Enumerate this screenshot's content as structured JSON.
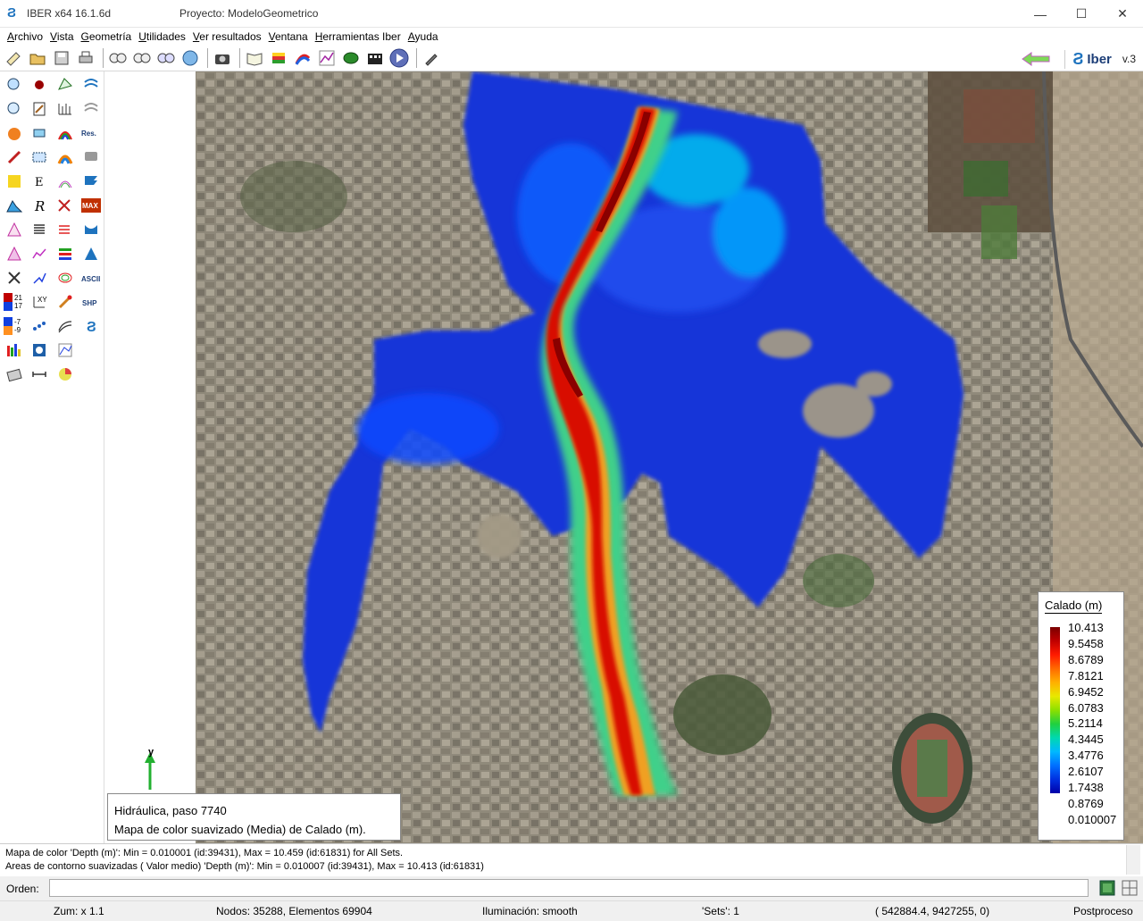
{
  "window": {
    "app_title": "IBER x64 16.1.6d",
    "project_title": "Proyecto: ModeloGeometrico",
    "minimize": "—",
    "maximize": "☐",
    "close": "✕"
  },
  "menu": [
    "Archivo",
    "Vista",
    "Geometría",
    "Utilidades",
    "Ver resultados",
    "Ventana",
    "Herramientas Iber",
    "Ayuda"
  ],
  "brand": {
    "logo_text": "Iber",
    "version": "v.3"
  },
  "legend": {
    "title": "Calado (m)",
    "values": [
      "10.413",
      "9.5458",
      "8.6789",
      "7.8121",
      "6.9452",
      "6.0783",
      "5.2114",
      "4.3445",
      "3.4776",
      "2.6107",
      "1.7438",
      "0.8769",
      "0.010007"
    ]
  },
  "left_panel_numbers": [
    "21",
    "17",
    "-7",
    "-9"
  ],
  "axis_label": "y",
  "info": {
    "line1": "Hidráulica, paso 7740",
    "line2": "Mapa de color suavizado (Media) de Calado (m)."
  },
  "messages": [
    "Mapa de color 'Depth (m)': Min = 0.010001 (id:39431), Max = 10.459 (id:61831) for All Sets.",
    "Areas de contorno suavizadas ( Valor medio) 'Depth (m)': Min = 0.010007 (id:39431), Max = 10.413 (id:61831)"
  ],
  "command": {
    "label": "Orden:",
    "value": ""
  },
  "status": {
    "zoom": "Zum: x 1.1",
    "nodes": "Nodos: 35288, Elementos 69904",
    "lighting": "Iluminación: smooth",
    "sets": "'Sets': 1",
    "coords": "( 542884.4,  9427255,  0)",
    "mode": "Postproceso"
  },
  "colors": {
    "accent_blue": "#1e73be",
    "depth_low": "#0000a8",
    "depth_high": "#7a0000"
  }
}
